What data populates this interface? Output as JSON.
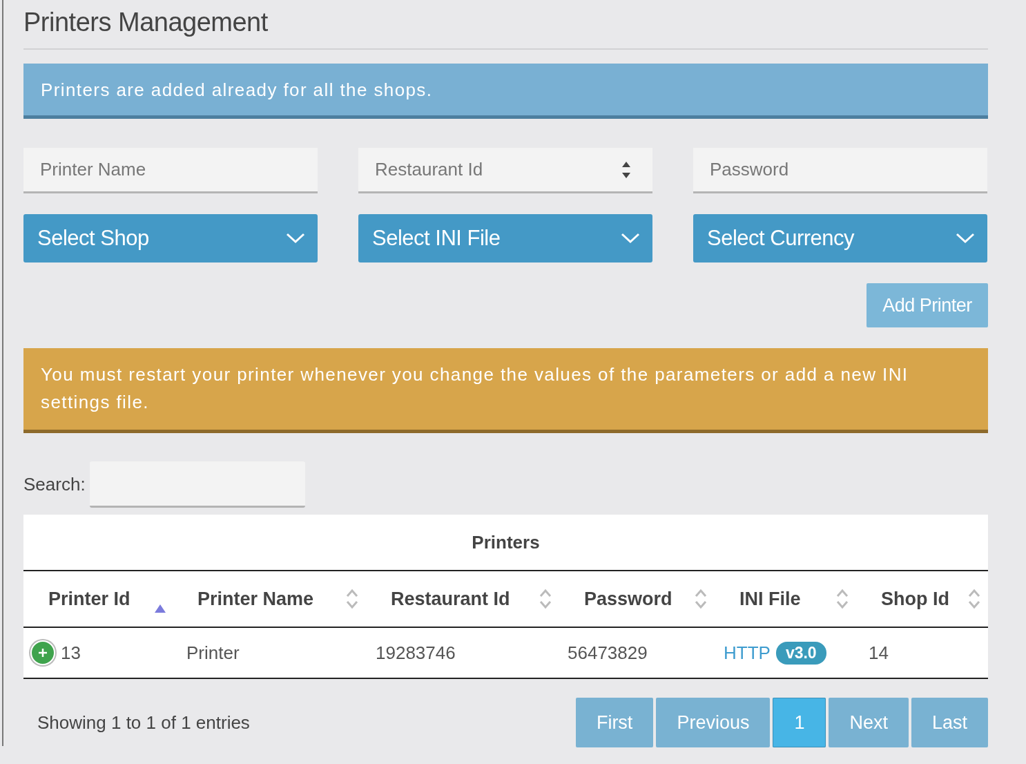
{
  "page_title": "Printers Management",
  "info_alert": "Printers are added already for all the shops.",
  "fields": [
    {
      "kind": "text",
      "placeholder": "Printer Name"
    },
    {
      "kind": "number",
      "placeholder": "Restaurant Id"
    },
    {
      "kind": "password",
      "placeholder": "Password"
    }
  ],
  "selects": [
    "Select Shop",
    "Select INI File",
    "Select Currency"
  ],
  "add_button": "Add Printer",
  "warning_alert": "You must restart your printer whenever you change the values of the parameters or add a new INI settings file.",
  "search": {
    "label": "Search:"
  },
  "table": {
    "caption": "Printers",
    "columns": [
      {
        "label": "Printer Id",
        "sorted": true
      },
      {
        "label": "Printer Name",
        "sorted": false
      },
      {
        "label": "Restaurant Id",
        "sorted": false
      },
      {
        "label": "Password",
        "sorted": false
      },
      {
        "label": "INI File",
        "sorted": false
      },
      {
        "label": "Shop Id",
        "sorted": false
      }
    ],
    "rows": [
      {
        "expanded": false,
        "printer_id": "13",
        "printer_name": "Printer",
        "restaurant_id": "19283746",
        "password": "56473829",
        "ini_file": {
          "link": "HTTP",
          "badge": "v3.0"
        },
        "shop_id": "14"
      }
    ]
  },
  "info": "Showing 1 to 1 of 1 entries",
  "pagination": [
    {
      "label": "First",
      "selected": false
    },
    {
      "label": "Previous",
      "selected": false
    },
    {
      "label": "1",
      "selected": true
    },
    {
      "label": "Next",
      "selected": false
    },
    {
      "label": "Last",
      "selected": false
    }
  ]
}
